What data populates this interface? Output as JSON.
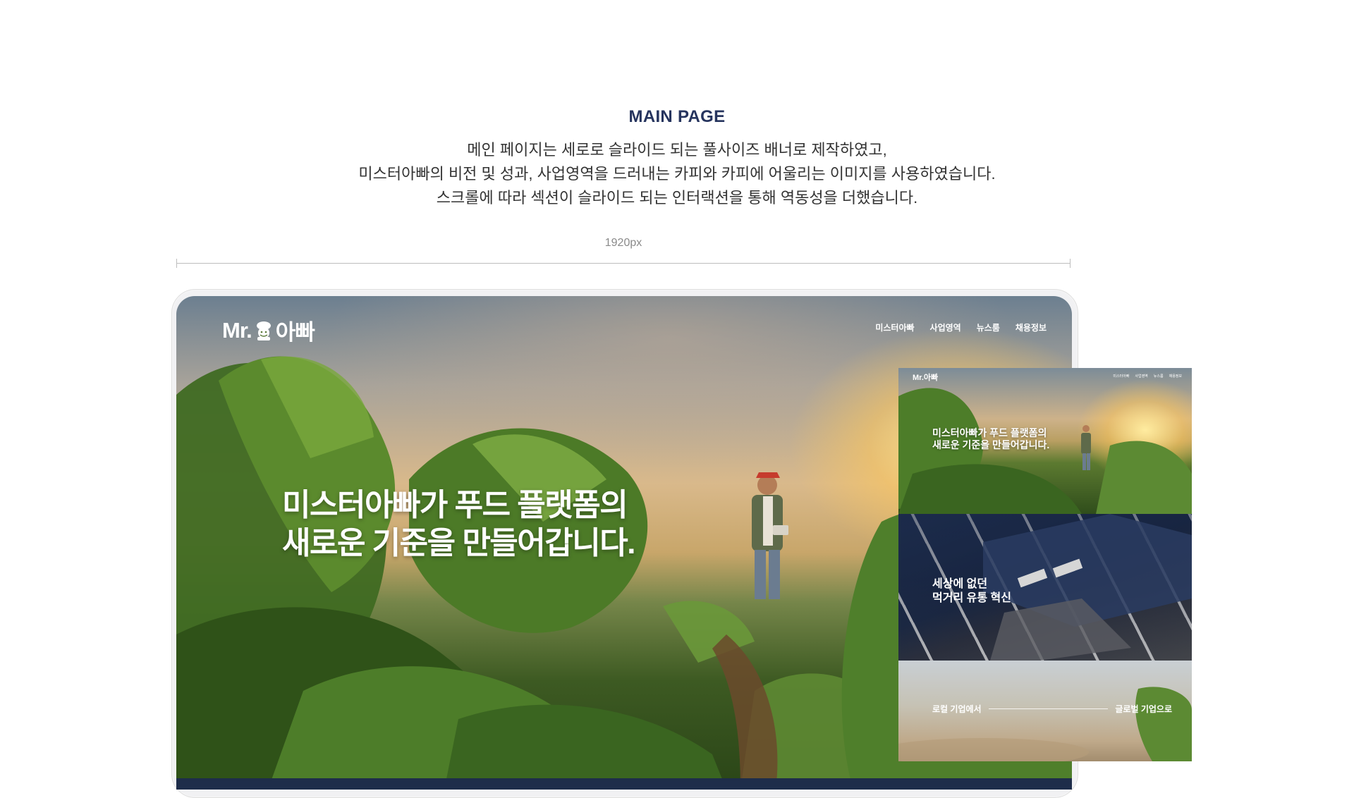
{
  "section": {
    "heading": "MAIN PAGE",
    "description": [
      "메인 페이지는 세로로 슬라이드 되는 풀사이즈 배너로 제작하였고,",
      "미스터아빠의 비전 및 성과, 사업영역을 드러내는 카피와 카피에 어울리는 이미지를 사용하였습니다.",
      "스크롤에 따라 섹션이 슬라이드 되는 인터랙션을 통해 역동성을 더했습니다."
    ],
    "width_label": "1920px"
  },
  "site": {
    "logo_text_left": "Mr.",
    "logo_text_right": "아빠",
    "logo_icon": "chef-mascot-icon",
    "nav": [
      "미스터아빠",
      "사업영역",
      "뉴스룸",
      "채용정보"
    ],
    "hero_title_line1": "미스터아빠가 푸드 플랫폼의",
    "hero_title_line2": "새로운 기준을 만들어갑니다."
  },
  "previews": {
    "panel1": {
      "logo": "Mr.아빠",
      "title_line1": "미스터아빠가 푸드 플랫폼의",
      "title_line2": "새로운 기준을 만들어갑니다."
    },
    "panel2": {
      "title_line1": "세상에 없던",
      "title_line2": "먹거리 유통 혁신"
    },
    "panel3": {
      "left": "로컬 기업에서",
      "right": "글로벌 기업으로"
    }
  },
  "colors": {
    "heading": "#26345e",
    "accent_navy": "#1e2d4a",
    "background": "#ffffff"
  }
}
